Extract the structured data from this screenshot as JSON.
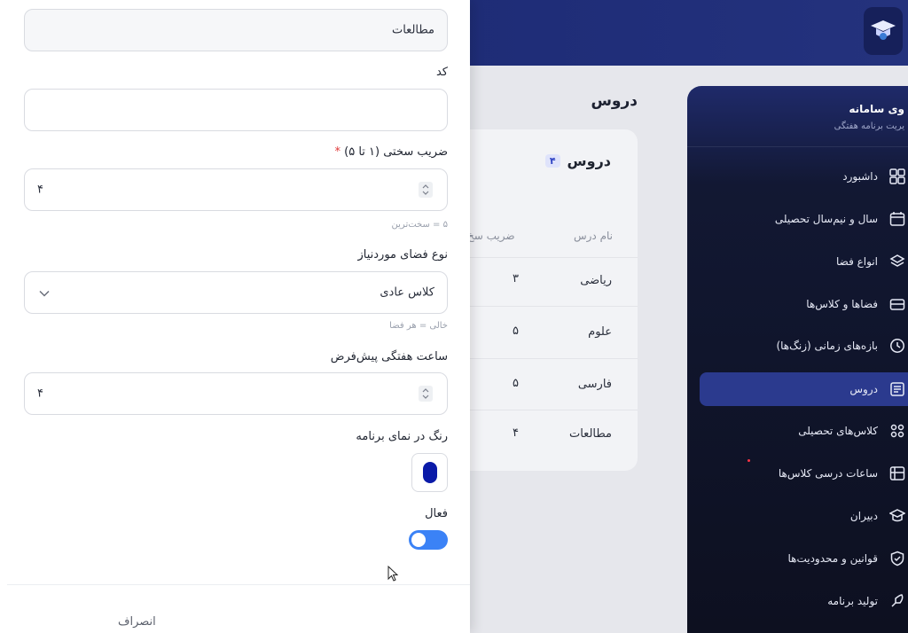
{
  "app": {
    "sidebar_title": "وی سامانه",
    "sidebar_subtitle": "یریت برنامه هفتگی"
  },
  "page": {
    "title": "دروس",
    "card_title": "دروس",
    "card_count": "۴"
  },
  "table": {
    "headers": [
      "نام درس",
      "ضریب سخ"
    ],
    "rows": [
      {
        "name": "ریاضی",
        "coef": "۳"
      },
      {
        "name": "علوم",
        "coef": "۵"
      },
      {
        "name": "فارسی",
        "coef": "۵"
      },
      {
        "name": "مطالعات",
        "coef": "۴"
      }
    ]
  },
  "sidebar": {
    "items": [
      {
        "label": "داشبورد",
        "icon": "dashboard-icon"
      },
      {
        "label": "سال و نیم‌سال تحصیلی",
        "icon": "calendar-icon"
      },
      {
        "label": "انواع فضا",
        "icon": "layers-icon"
      },
      {
        "label": "فضاها و کلاس‌ها",
        "icon": "classroom-icon"
      },
      {
        "label": "بازه‌های زمانی (زنگ‌ها)",
        "icon": "clock-icon"
      },
      {
        "label": "دروس",
        "icon": "book-icon",
        "active": true
      },
      {
        "label": "کلاس‌های تحصیلی",
        "icon": "groups-icon"
      },
      {
        "label": "ساعات درسی کلاس‌ها",
        "icon": "schedule-icon"
      },
      {
        "label": "دبیران",
        "icon": "teacher-icon"
      },
      {
        "label": "قوانین و محدودیت‌ها",
        "icon": "shield-icon"
      },
      {
        "label": "تولید برنامه",
        "icon": "rocket-icon"
      }
    ]
  },
  "form": {
    "name_value": "مطالعات",
    "code_label": "کد",
    "code_value": "",
    "difficulty_label": "ضریب سختی (۱ تا ۵)",
    "difficulty_required": "*",
    "difficulty_value": "۴",
    "difficulty_hint": "۵ = سخت‌ترین",
    "space_type_label": "نوع فضای موردنیاز",
    "space_type_value": "کلاس عادی",
    "space_type_hint": "خالی = هر فضا",
    "weekly_hours_label": "ساعت هفتگی پیش‌فرض",
    "weekly_hours_value": "۴",
    "color_label": "رنگ در نمای برنامه",
    "color_value": "#0a1aa8",
    "active_label": "فعال",
    "active_on": true,
    "cancel_label": "انصراف"
  }
}
